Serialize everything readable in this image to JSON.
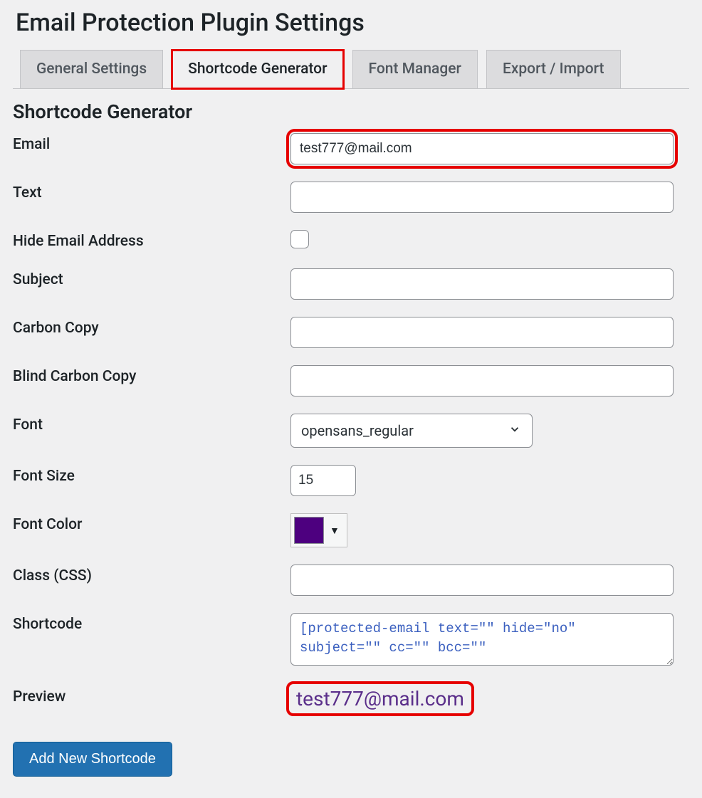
{
  "page_title": "Email Protection Plugin Settings",
  "tabs": [
    {
      "label": "General Settings",
      "active": false,
      "highlight": false
    },
    {
      "label": "Shortcode Generator",
      "active": true,
      "highlight": true
    },
    {
      "label": "Font Manager",
      "active": false,
      "highlight": false
    },
    {
      "label": "Export / Import",
      "active": false,
      "highlight": false
    }
  ],
  "section_title": "Shortcode Generator",
  "fields": {
    "email": {
      "label": "Email",
      "value": "test777@mail.com",
      "highlight": true
    },
    "text": {
      "label": "Text",
      "value": ""
    },
    "hide": {
      "label": "Hide Email Address",
      "checked": false
    },
    "subject": {
      "label": "Subject",
      "value": ""
    },
    "cc": {
      "label": "Carbon Copy",
      "value": ""
    },
    "bcc": {
      "label": "Blind Carbon Copy",
      "value": ""
    },
    "font": {
      "label": "Font",
      "value": "opensans_regular"
    },
    "font_size": {
      "label": "Font Size",
      "value": "15"
    },
    "font_color": {
      "label": "Font Color",
      "value": "#4d007f"
    },
    "css_class": {
      "label": "Class (CSS)",
      "value": ""
    },
    "shortcode": {
      "label": "Shortcode",
      "value": "[protected-email text=\"\" hide=\"no\" subject=\"\" cc=\"\" bcc=\"\""
    },
    "preview": {
      "label": "Preview",
      "value": "test777@mail.com",
      "highlight": true
    }
  },
  "button": {
    "add": "Add New Shortcode"
  }
}
